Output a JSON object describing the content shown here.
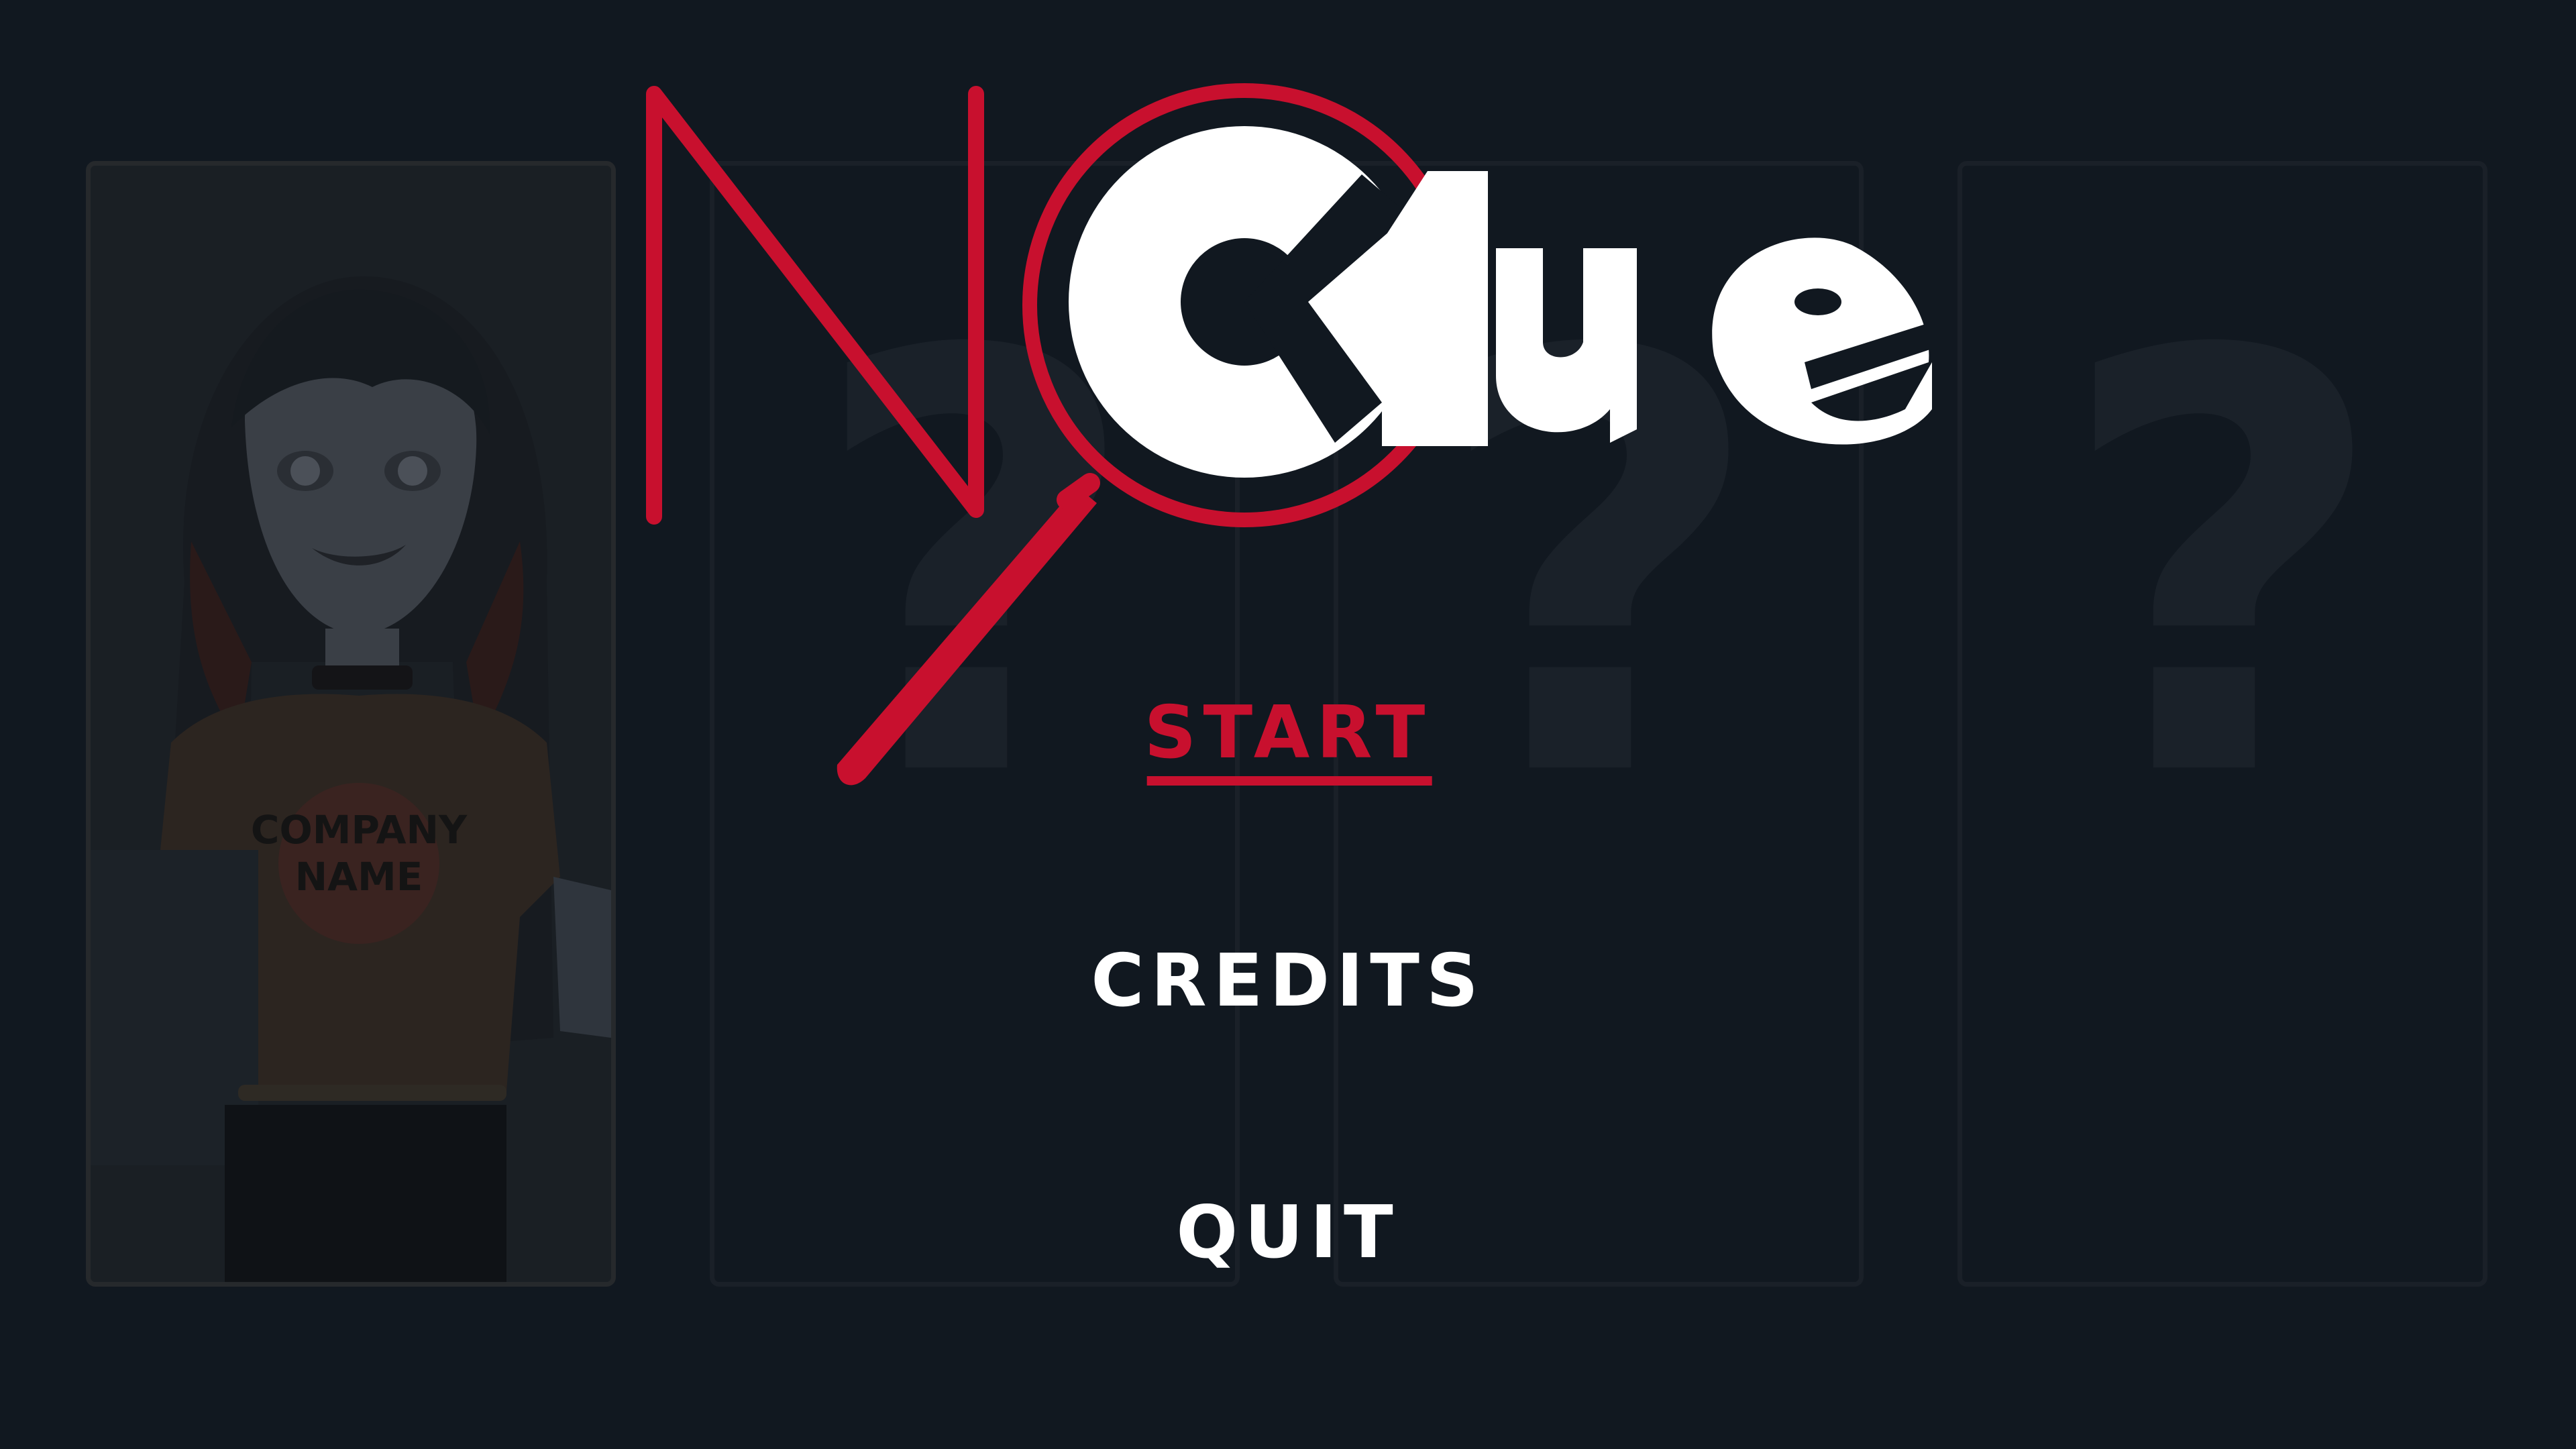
{
  "game": {
    "logo_text_no": "N",
    "logo_text_clue": "Clue"
  },
  "menu": {
    "items": [
      {
        "label": "START",
        "active": true
      },
      {
        "label": "CREDITS",
        "active": false
      },
      {
        "label": "QUIT",
        "active": false
      }
    ]
  },
  "cards": [
    {
      "state": "unlocked",
      "shirt_text": "COMPANY NAME"
    },
    {
      "state": "locked",
      "symbol": "?"
    },
    {
      "state": "locked",
      "symbol": "?"
    },
    {
      "state": "locked",
      "symbol": "?"
    }
  ],
  "colors": {
    "background": "#111820",
    "accent": "#c8102e",
    "menu_text": "#ffffff",
    "locked_symbol": "#1a2129"
  }
}
